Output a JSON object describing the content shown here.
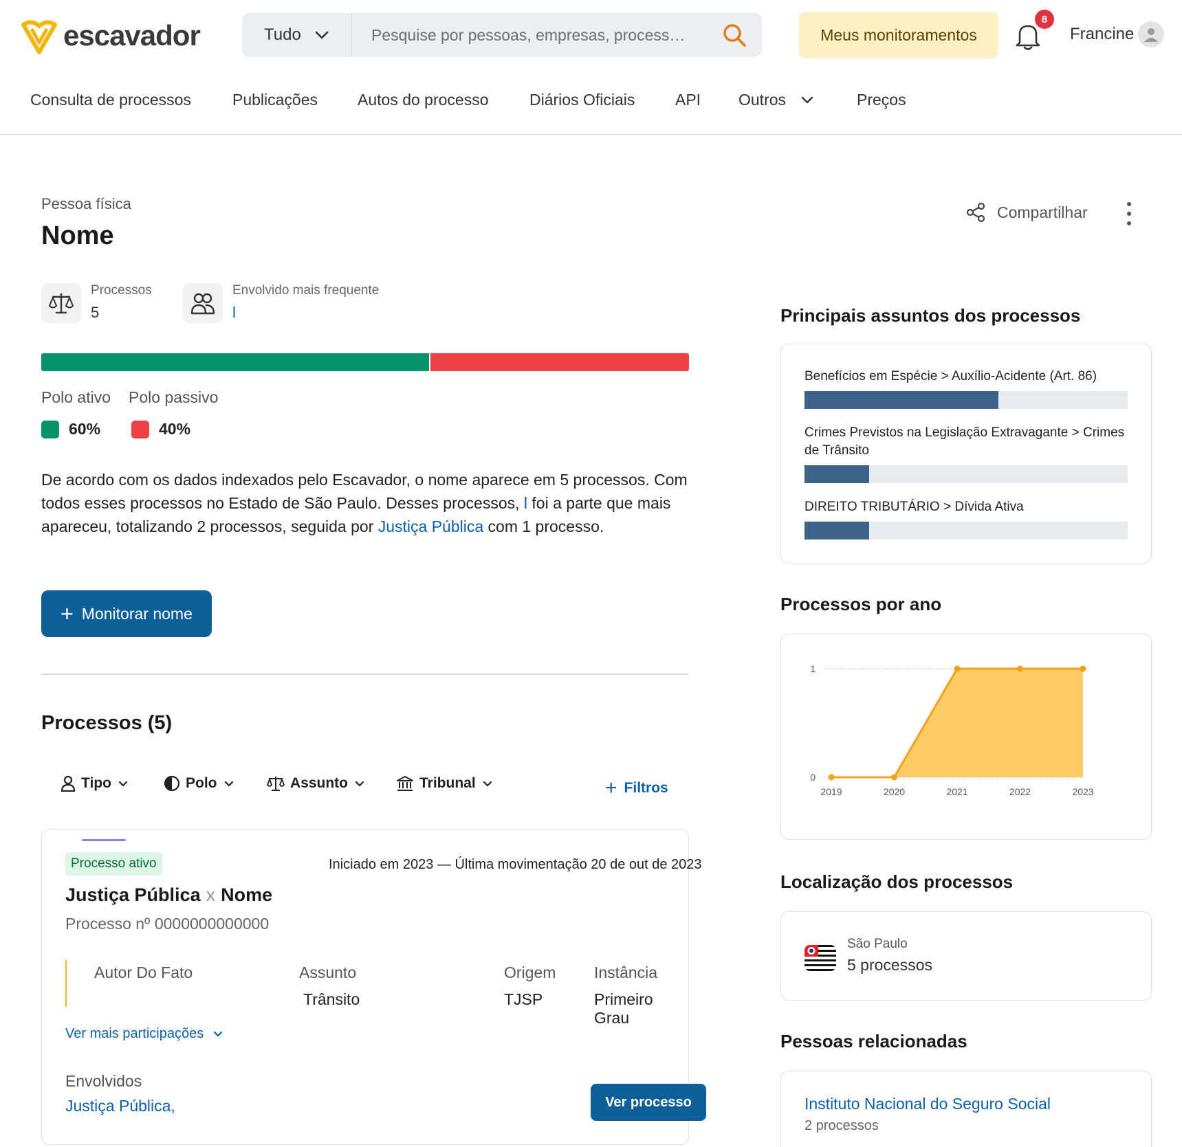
{
  "brand": {
    "name": "escavador",
    "accent": "#f5b50f"
  },
  "search": {
    "type_label": "Tudo",
    "placeholder": "Pesquise por pessoas, empresas, process…"
  },
  "header": {
    "monitor_label": "Meus monitoramentos",
    "notification_count": "8",
    "user_name": "Francine"
  },
  "nav": {
    "items": [
      {
        "label": "Consulta de processos"
      },
      {
        "label": "Publicações"
      },
      {
        "label": "Autos do processo"
      },
      {
        "label": "Diários Oficiais"
      },
      {
        "label": "API"
      },
      {
        "label": "Outros"
      },
      {
        "label": "Preços"
      }
    ]
  },
  "person": {
    "type": "Pessoa física",
    "name": "Nome",
    "share_label": "Compartilhar"
  },
  "stats": {
    "processos_label": "Processos",
    "processos_value": "5",
    "envolvido_label": "Envolvido mais frequente",
    "envolvido_value": "l"
  },
  "polo": {
    "ativo_label": "Polo ativo",
    "passivo_label": "Polo passivo",
    "ativo_pct": "60%",
    "passivo_pct": "40%",
    "ativo_fraction": 0.6,
    "ativo_color": "#06936a",
    "passivo_color": "#ec4245"
  },
  "summary": {
    "part1": "De acordo com os dados indexados pelo Escavador, o nome  aparece em 5 processos. Com todos esses processos no Estado de São Paulo. Desses processos, ",
    "highlight1": "l",
    "part2": " foi a parte que mais apareceu, totalizando 2 processos, seguida por ",
    "link2": "Justiça Pública",
    "part3": " com 1 processo."
  },
  "monitor_button": "Monitorar nome",
  "processos_section": {
    "title": "Processos (5)",
    "filters": [
      "Tipo",
      "Polo",
      "Assunto",
      "Tribunal"
    ],
    "filtros_label": "Filtros"
  },
  "process_card": {
    "status": "Processo ativo",
    "meta": "Iniciado em 2023 — Última movimentação 20 de out de 2023",
    "party_a": "Justiça Pública",
    "versus": "x",
    "party_b": "Nome",
    "number": "Processo nº 0000000000000",
    "columns": [
      {
        "label": "Autor Do Fato",
        "value": ""
      },
      {
        "label": "Assunto",
        "value": "Trânsito"
      },
      {
        "label": "Origem",
        "value": "TJSP"
      },
      {
        "label": "Instância",
        "value": "Primeiro Grau"
      }
    ],
    "ver_mais": "Ver mais participações",
    "envolvidos_label": "Envolvidos",
    "envolvidos_value": "Justiça Pública,",
    "ver_processo": "Ver processo"
  },
  "assuntos": {
    "title": "Principais assuntos dos processos",
    "items": [
      {
        "label": "Benefícios em Espécie > Auxílio-Acidente (Art. 86)",
        "fraction": 0.6
      },
      {
        "label": "Crimes Previstos na Legislação Extravagante > Crimes de Trânsito",
        "fraction": 0.2
      },
      {
        "label": "DIREITO TRIBUTÁRIO > Dívida Ativa",
        "fraction": 0.2
      }
    ],
    "bar_color": "#3f6289"
  },
  "chart_data": {
    "type": "area",
    "title": "Processos por ano",
    "x": [
      "2019",
      "2020",
      "2021",
      "2022",
      "2023"
    ],
    "values": [
      0,
      0,
      1,
      1,
      1
    ],
    "ylim": [
      0,
      1
    ],
    "yticks": [
      "0",
      "1"
    ],
    "line_color": "#f0a21a",
    "fill_color": "#fecb66",
    "grid": true
  },
  "localizacao": {
    "title": "Localização dos processos",
    "state": "São Paulo",
    "count": "5 processos"
  },
  "pessoas": {
    "title": "Pessoas relacionadas",
    "items": [
      {
        "name": "Instituto Nacional do Seguro Social",
        "count": "2 processos"
      }
    ]
  }
}
